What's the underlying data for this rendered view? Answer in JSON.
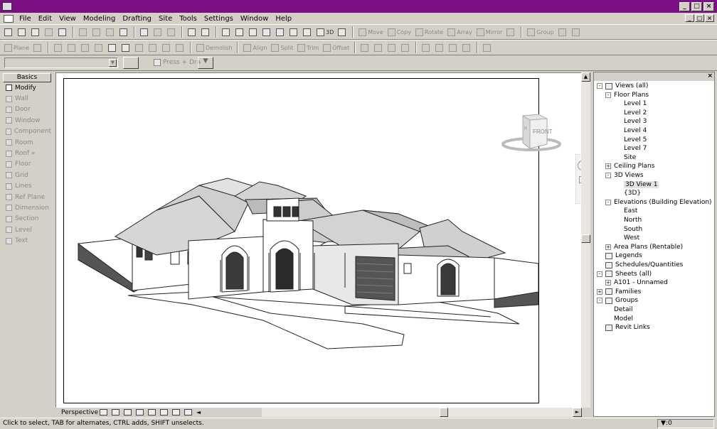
{
  "menu": [
    "File",
    "Edit",
    "View",
    "Modeling",
    "Drafting",
    "Site",
    "Tools",
    "Settings",
    "Window",
    "Help"
  ],
  "window_buttons": {
    "minimize": "_",
    "maximize": "□",
    "close": "×"
  },
  "toolbar1": {
    "tool_3d": "3D",
    "move": "Move",
    "copy": "Copy",
    "rotate": "Rotate",
    "array": "Array",
    "mirror": "Mirror",
    "group": "Group"
  },
  "toolbar2": {
    "plane": "Plane",
    "demolish": "Demolish",
    "align": "Align",
    "split": "Split",
    "trim": "Trim",
    "offset": "Offset"
  },
  "options_bar": {
    "press_drag": "Press + Dra"
  },
  "design_bar": {
    "tab": "Basics",
    "items": [
      "Modify",
      "Wall",
      "Door",
      "Window",
      "Component",
      "Room",
      "Roof »",
      "Floor",
      "Grid",
      "Lines",
      "Ref Plane",
      "Dimension",
      "Section",
      "Level",
      "Text"
    ]
  },
  "view_cube": {
    "front": "FRONT",
    "side": "R"
  },
  "view_control": {
    "label": "Perspective"
  },
  "project_browser": {
    "views_all": "Views (all)",
    "floor_plans": "Floor Plans",
    "levels": [
      "Level 1",
      "Level 2",
      "Level 3",
      "Level 4",
      "Level 5",
      "Level 7",
      "Site"
    ],
    "ceiling_plans": "Ceiling Plans",
    "views_3d": "3D Views",
    "views_3d_items": [
      "3D View 1",
      "{3D}"
    ],
    "elevations": "Elevations (Building Elevation)",
    "elev_items": [
      "East",
      "North",
      "South",
      "West"
    ],
    "area_plans": "Area Plans (Rentable)",
    "legends": "Legends",
    "schedules": "Schedules/Quantities",
    "sheets": "Sheets (all)",
    "sheet_item": "A101 - Unnamed",
    "families": "Families",
    "groups": "Groups",
    "group_items": [
      "Detail",
      "Model"
    ],
    "revit_links": "Revit Links"
  },
  "status": {
    "text": "Click to select, TAB for alternates, CTRL adds, SHIFT unselects.",
    "filter_count": ":0"
  },
  "colors": {
    "titlebar": "#7a0f86",
    "chrome": "#d4d0c8"
  }
}
